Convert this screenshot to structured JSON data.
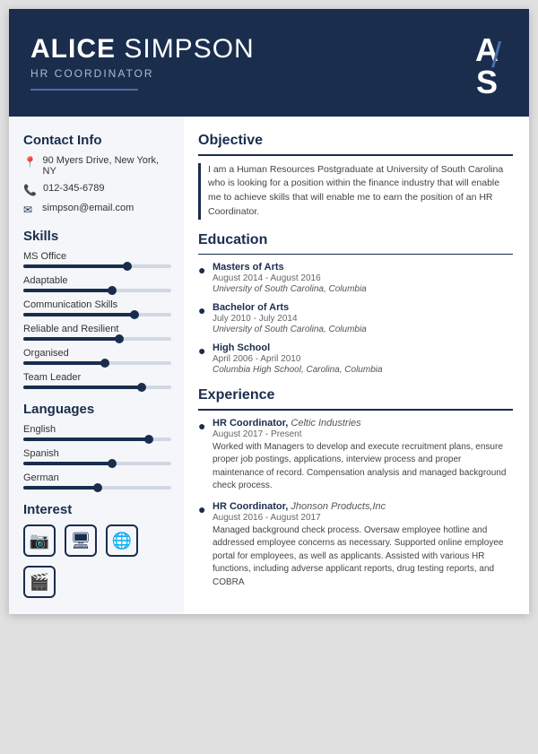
{
  "header": {
    "first_name": "ALICE",
    "last_name": "SIMPSON",
    "title": "HR COORDINATOR",
    "monogram_a": "A",
    "monogram_s": "S"
  },
  "sidebar": {
    "contact_title": "Contact Info",
    "contact_address": "90 Myers Drive, New York, NY",
    "contact_phone": "012-345-6789",
    "contact_email": "simpson@email.com",
    "skills_title": "Skills",
    "skills": [
      {
        "label": "MS Office",
        "pct": 70
      },
      {
        "label": "Adaptable",
        "pct": 60
      },
      {
        "label": "Communication Skills",
        "pct": 75
      },
      {
        "label": "Reliable and Resilient",
        "pct": 65
      },
      {
        "label": "Organised",
        "pct": 55
      },
      {
        "label": "Team Leader",
        "pct": 80
      }
    ],
    "languages_title": "Languages",
    "languages": [
      {
        "label": "English",
        "pct": 85
      },
      {
        "label": "Spanish",
        "pct": 60
      },
      {
        "label": "German",
        "pct": 50
      }
    ],
    "interest_title": "Interest"
  },
  "main": {
    "objective_title": "Objective",
    "objective_text": "I am a Human Resources Postgraduate at University of South Carolina who is looking for a position within the finance industry that will enable me to achieve skills that will enable me to earn the position of an HR Coordinator.",
    "education_title": "Education",
    "education": [
      {
        "degree": "Masters of Arts",
        "date": "August 2014 - August 2016",
        "institution": "University of South Carolina, Columbia"
      },
      {
        "degree": "Bachelor of Arts",
        "date": "July 2010 - July 2014",
        "institution": "University of South Carolina, Columbia"
      },
      {
        "degree": "High School",
        "date": "April 2006 - April 2010",
        "institution": "Columbia High School, Carolina, Columbia"
      }
    ],
    "experience_title": "Experience",
    "experience": [
      {
        "role": "HR Coordinator",
        "company": "Celtic Industries",
        "date": "August 2017 - Present",
        "desc": "Worked with Managers to develop and execute recruitment plans, ensure proper job postings, applications, interview process and proper maintenance of record. Compensation analysis and managed background check process."
      },
      {
        "role": "HR Coordinator",
        "company": "Jhonson Products,Inc",
        "date": "August 2016 - August 2017",
        "desc": "Managed background check process. Oversaw employee hotline and addressed employee concerns as necessary. Supported online employee portal for employees, as well as applicants. Assisted with various HR functions, including adverse applicant reports, drug testing reports, and COBRA"
      }
    ]
  }
}
